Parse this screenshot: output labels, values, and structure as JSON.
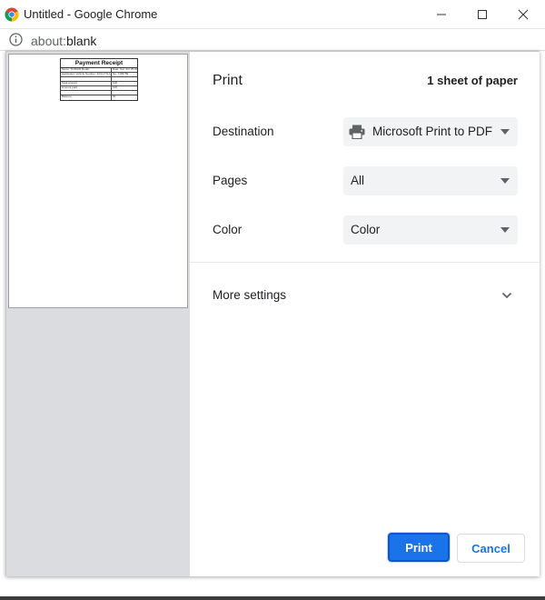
{
  "window": {
    "title": "Untitled - Google Chrome",
    "controls": {
      "minimize": "minimize-icon",
      "maximize": "maximize-icon",
      "close": "close-icon"
    }
  },
  "address_bar": {
    "scheme": "about:",
    "host": "blank",
    "icon": "info-icon"
  },
  "preview": {
    "receipt": {
      "title": "Payment Receipt",
      "rows": [
        {
          "left": "Name: SUDHIR Reddy",
          "right": "Date: Sun Jun 25 2023"
        },
        {
          "left": "Application Vehicle Number: 4US1-TN-1430",
          "right": "No: 7495789"
        },
        {
          "left": "",
          "right": ""
        },
        {
          "left": "Total amount",
          "right": "100"
        },
        {
          "left": "Amount paid",
          "right": "100"
        },
        {
          "left": "",
          "right": ""
        },
        {
          "left": "Balance",
          "right": "00"
        }
      ]
    }
  },
  "print": {
    "title": "Print",
    "sheet_count": "1 sheet of paper",
    "destination": {
      "label": "Destination",
      "value": "Microsoft Print to PDF",
      "icon": "printer-icon"
    },
    "pages": {
      "label": "Pages",
      "value": "All"
    },
    "color": {
      "label": "Color",
      "value": "Color"
    },
    "more_settings": {
      "label": "More settings",
      "icon": "chevron-down-icon"
    },
    "buttons": {
      "print": "Print",
      "cancel": "Cancel"
    }
  },
  "colors": {
    "accent": "#1a73e8",
    "select_bg": "#f1f3f4",
    "preview_bg": "#dadce0"
  }
}
